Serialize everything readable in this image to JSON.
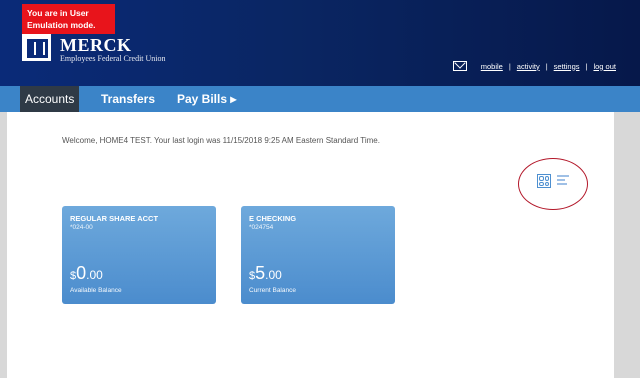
{
  "emulation_notice": "You are in User Emulation mode.",
  "brand": {
    "name": "MERCK",
    "subtitle": "Employees Federal Credit Union"
  },
  "utility_links": [
    "mobile",
    "activity",
    "settings",
    "log out"
  ],
  "nav": {
    "items": [
      "Accounts",
      "Transfers",
      "Pay Bills ▸"
    ]
  },
  "welcome": "Welcome, HOME4 TEST. Your last login was 11/15/2018 9:25 AM Eastern Standard Time.",
  "view_toggle": {
    "icons": [
      "grid-view-icon",
      "list-view-icon"
    ]
  },
  "accounts": [
    {
      "name": "REGULAR SHARE ACCT",
      "number": "*024-00",
      "currency": "$",
      "whole": "0",
      "cents": ".00",
      "balance_label": "Available Balance"
    },
    {
      "name": "E CHECKING",
      "number": "*024754",
      "currency": "$",
      "whole": "5",
      "cents": ".00",
      "balance_label": "Current Balance"
    }
  ],
  "colors": {
    "header": "#0a2a78",
    "nav": "#3b84c8",
    "active_tab": "#2f3a46",
    "card": "#5b9bd5",
    "alert": "#e8141b"
  }
}
